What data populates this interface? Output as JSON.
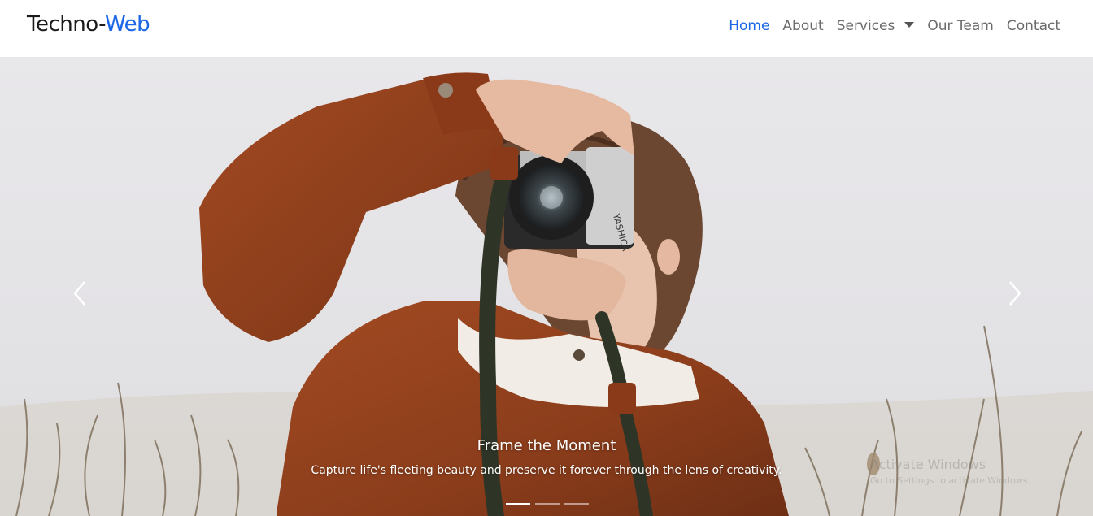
{
  "navbar": {
    "brand_main": "Techno-",
    "brand_accent": "Web",
    "links": [
      {
        "label": "Home",
        "active": true
      },
      {
        "label": "About",
        "active": false
      },
      {
        "label": "Services",
        "active": false,
        "has_dropdown": true
      },
      {
        "label": "Our Team",
        "active": false
      },
      {
        "label": "Contact",
        "active": false
      }
    ]
  },
  "carousel": {
    "slides_count": 3,
    "active_slide": 1,
    "caption_title": "Frame the Moment",
    "caption_text": "Capture life's fleeting beauty and preserve it forever through the lens of creativity.",
    "camera_brand": "YASHICA",
    "prev_icon": "chevron-left-icon",
    "next_icon": "chevron-right-icon"
  },
  "overlay": {
    "watermark_title": "Activate Windows",
    "watermark_subtitle": "Go to Settings to activate Windows."
  },
  "colors": {
    "accent": "#1a66e6",
    "nav_text": "#6b6b6b",
    "jacket": "#8b3f1c",
    "fog": "#e3e2e5"
  }
}
